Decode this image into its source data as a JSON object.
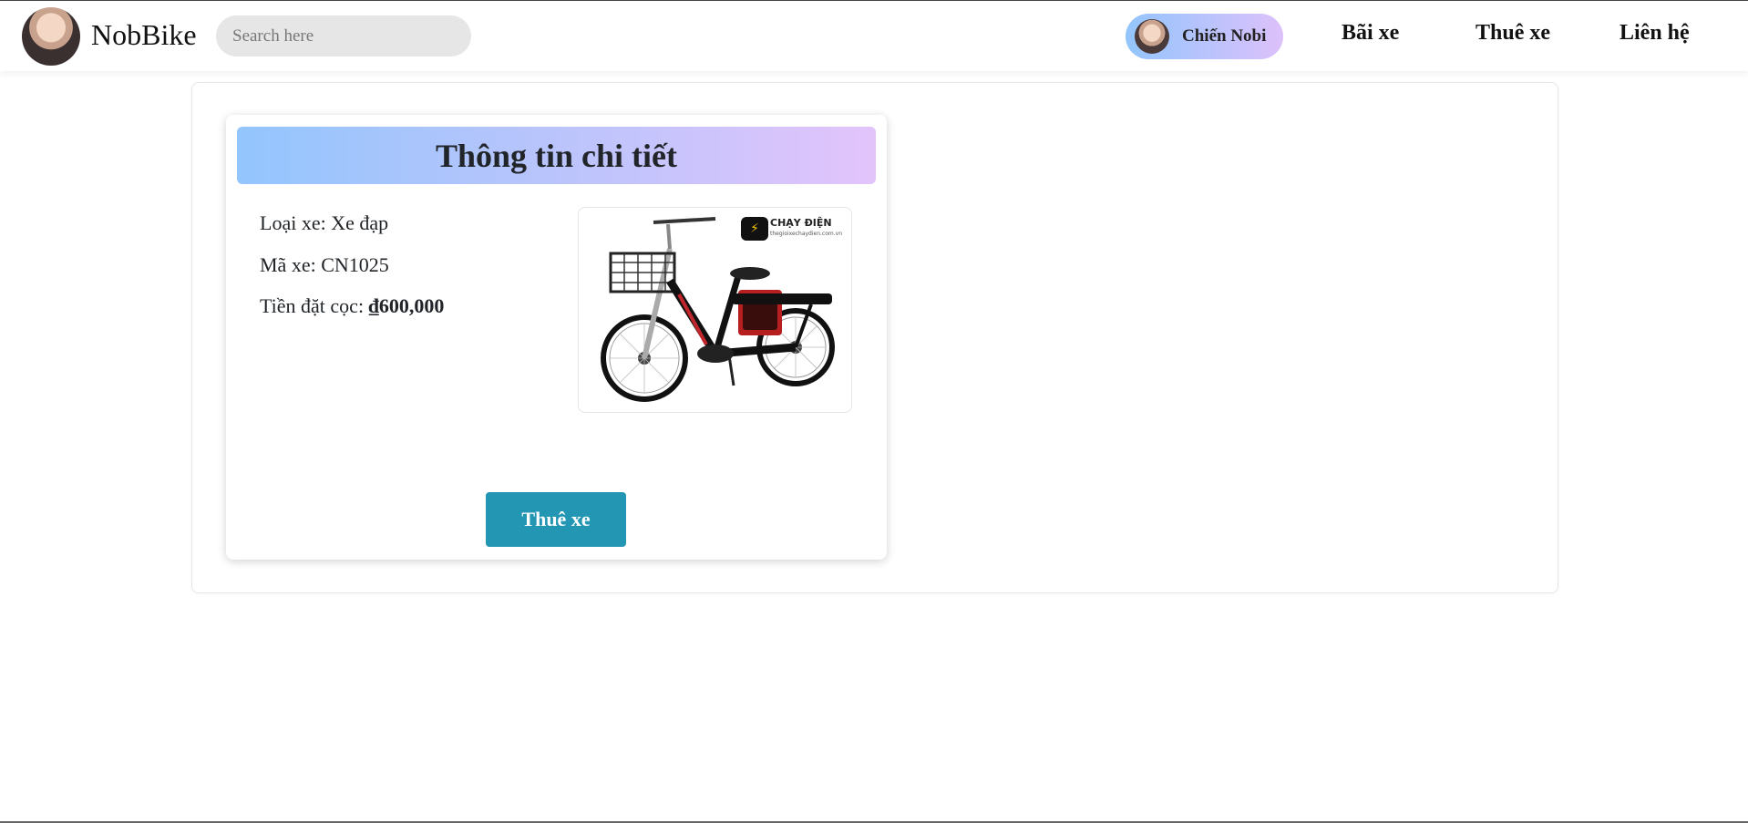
{
  "navbar": {
    "brand": "NobBike",
    "search_placeholder": "Search here",
    "user_name": "Chiến Nobi",
    "links": [
      "Bãi xe",
      "Thuê xe",
      "Liên hệ"
    ]
  },
  "detail": {
    "title": "Thông tin chi tiết",
    "type_label": "Loại xe: ",
    "type_value": "Xe đạp",
    "code_label": "Mã xe: ",
    "code_value": "CN1025",
    "deposit_label": "Tiền đặt cọc: ",
    "deposit_value": "₫600,000",
    "image_badge": "CHẠY ĐIỆN",
    "image_badge_site": "thegioixechaydien.com.vn",
    "rent_button": "Thuê xe"
  },
  "colors": {
    "accent_button": "#2296b3",
    "gradient_start": "#93c5fd",
    "gradient_end": "#e2c4fb"
  },
  "icons": {
    "logo": "user-avatar-icon",
    "product": "electric-bicycle-image"
  }
}
